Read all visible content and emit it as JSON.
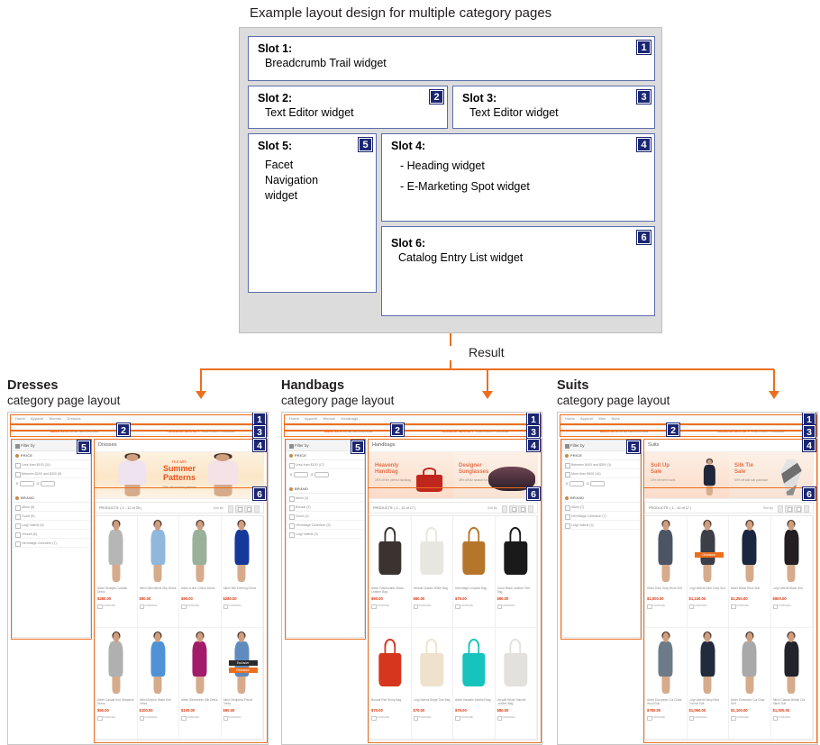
{
  "diagram": {
    "title": "Example layout design for multiple category pages",
    "result_label": "Result",
    "slots": [
      {
        "n": "1",
        "title": "Slot 1:",
        "lines": [
          "Breadcrumb Trail widget"
        ]
      },
      {
        "n": "2",
        "title": "Slot 2:",
        "lines": [
          "Text Editor widget"
        ]
      },
      {
        "n": "3",
        "title": "Slot 3:",
        "lines": [
          "Text Editor widget"
        ]
      },
      {
        "n": "4",
        "title": "Slot 4:",
        "lines": [
          "- Heading widget",
          "- E-Marketing Spot widget"
        ]
      },
      {
        "n": "5",
        "title": "Slot 5:",
        "lines": [
          "Facet",
          "Navigation",
          "widget"
        ]
      },
      {
        "n": "6",
        "title": "Slot 6:",
        "lines": [
          "Catalog Entry List widget"
        ]
      }
    ],
    "colors": {
      "badge_bg": "#1b2673",
      "slot_border": "#5b6eae",
      "frame_bg": "#dcdcdc",
      "connector": "#ec6f1e"
    }
  },
  "common": {
    "promo_left_bold": "SAVE 20%",
    "promo_left_rest": "on all New Arrivals",
    "promo_right_bold": "RECEIVE 15% OFF",
    "promo_right_rest": "Your Entire Purchase",
    "filter_by": "Filter by",
    "price_label": "PRICE",
    "brand_label": "BRAND",
    "currency_symbol": "$",
    "sort_by": "Sort By",
    "compare_label": "COMPARE",
    "subheading": "category page layout",
    "badges": [
      "1",
      "2",
      "3",
      "4",
      "5",
      "6"
    ]
  },
  "pages": [
    {
      "heading": "Dresses",
      "breadcrumb": [
        "Home",
        "Apparel",
        "Women",
        "Dresses"
      ],
      "category_title": "Dresses",
      "products_label": "PRODUCTS: ( 1 - 12 of 39 )",
      "price_facets": [
        "Less than $100 (31)",
        "Between $200 and $300 (8)"
      ],
      "brand_facets": [
        "Albini (8)",
        "Gucci (6)",
        "Luigi Valenti (8)",
        "Versalli (8)",
        "Hermitage Collection (7)"
      ],
      "ems": {
        "style": "single",
        "center": {
          "line1": "Hot with",
          "line2a": "Summer",
          "line2b": "Patterns",
          "line3": "20% off summer patterns"
        }
      },
      "products": [
        {
          "name": "Albini Straight Cocktail Dress",
          "price": "$280.00",
          "tone": "#b6b6b6",
          "ribbon": ""
        },
        {
          "name": "Albini Sleeveless Slip Dress",
          "price": "$90.00",
          "tone": "#8fb8dd",
          "ribbon": ""
        },
        {
          "name": "Albini A-line Cotton Dress",
          "price": "$90.00",
          "tone": "#9ab09a",
          "ribbon": ""
        },
        {
          "name": "Albini Silk Evening Dress",
          "price": "$280.00",
          "tone": "#15399b",
          "ribbon": ""
        },
        {
          "name": "Albini Casual Knit Strapless Dress",
          "price": "$90.00",
          "tone": "#b0b0b0",
          "ribbon": ""
        },
        {
          "name": "Albini Empire Waist Knit Dress",
          "price": "$100.00",
          "tone": "#4f93d6",
          "ribbon": ""
        },
        {
          "name": "Albini Sleeveless Silk Dress",
          "price": "$100.00",
          "tone": "#a31c6b",
          "ribbon": ""
        },
        {
          "name": "Albini Strapless Pencil Dress",
          "price": "$90.00",
          "tone": "#5f8bbe",
          "ribbon": "both"
        }
      ]
    },
    {
      "heading": "Handbags",
      "breadcrumb": [
        "Home",
        "Apparel",
        "Women",
        "Handbags"
      ],
      "category_title": "Handbags",
      "products_label": "PRODUCTS: ( 1 - 12 of 17 )",
      "price_facets": [
        "Less than $100 (17)"
      ],
      "brand_facets": [
        "Albini (3)",
        "Bonadi (3)",
        "Gucci (3)",
        "Hermitage Collection (3)",
        "Luigi Valenti (3)"
      ],
      "ems": {
        "style": "double",
        "left": {
          "line1a": "Heavenly",
          "line1b": "Handbag",
          "line2": "25% off the perfect handbag"
        },
        "right": {
          "line1a": "Designer",
          "line1b": "Sunglasses",
          "line2": "35% off the season's hottest styles"
        }
      },
      "products": [
        {
          "name": "Albini Fashionable Black Leather Bag",
          "price": "$90.00",
          "tone": "#3a3330",
          "ribbon": ""
        },
        {
          "name": "Versalli Classic White Bag",
          "price": "$60.00",
          "tone": "#e8e6e1",
          "ribbon": ""
        },
        {
          "name": "Hermitage Leopard Bag",
          "price": "$75.00",
          "tone": "#b5762c",
          "ribbon": ""
        },
        {
          "name": "Gucci Black Leather Tote Bag",
          "price": "$90.00",
          "tone": "#1a1a1a",
          "ribbon": ""
        },
        {
          "name": "Bonadi Red Shiny Bag",
          "price": "$70.00",
          "tone": "#d6361e",
          "ribbon": ""
        },
        {
          "name": "Luigi Valenti Beige Tote Bag",
          "price": "$70.00",
          "tone": "#efe2cc",
          "ribbon": ""
        },
        {
          "name": "Albini Hawaiin Satchel Bag",
          "price": "$75.00",
          "tone": "#16c4bd",
          "ribbon": ""
        },
        {
          "name": "Versalli White Satchel Leather Bag",
          "price": "$80.00",
          "tone": "#e3e1dd",
          "ribbon": ""
        }
      ]
    },
    {
      "heading": "Suits",
      "breadcrumb": [
        "Home",
        "Apparel",
        "Men",
        "Suits"
      ],
      "category_title": "Suits",
      "products_label": "PRODUCTS: ( 1 - 12 of 17 )",
      "price_facets": [
        "Between $400 and $500 (1)",
        "More than $500 (16)"
      ],
      "brand_facets": [
        "Albini (7)",
        "Hermitage Collection (7)",
        "Luigi Valenti (3)"
      ],
      "ems": {
        "style": "double",
        "left": {
          "line1a": "Suit Up",
          "line1b": "Sale",
          "line2": "20% off men's suits"
        },
        "right": {
          "line1a": "Silk Tie",
          "line1b": "Sale",
          "line2": "50% off with suit purchase"
        }
      },
      "products": [
        {
          "name": "Albini Dark Gray Wool Suit",
          "price": "$1,000.00",
          "tone": "#4b5564",
          "ribbon": ""
        },
        {
          "name": "Luigi Valenti Dark Gray Suit",
          "price": "$1,240.00",
          "tone": "#3c3f47",
          "ribbon": "clear"
        },
        {
          "name": "Albini Black Wool Suit",
          "price": "$1,250.00",
          "tone": "#1b2740",
          "ribbon": ""
        },
        {
          "name": "Luigi Valenti Black Suit",
          "price": "$900.00",
          "tone": "#241d22",
          "ribbon": ""
        },
        {
          "name": "Albini European Cut Chalk Wool Suit",
          "price": "$780.00",
          "tone": "#6d7b89",
          "ribbon": ""
        },
        {
          "name": "Luigi Valenti Navy Blue Formal Suit",
          "price": "$1,060.00",
          "tone": "#222a3e",
          "ribbon": ""
        },
        {
          "name": "Albini Executive Cut Gray Suit",
          "price": "$1,100.00",
          "tone": "#a9a9a9",
          "ribbon": ""
        },
        {
          "name": "Albini Classic British Cut Black Suit",
          "price": "$1,300.00",
          "tone": "#23232b",
          "ribbon": ""
        }
      ]
    }
  ]
}
